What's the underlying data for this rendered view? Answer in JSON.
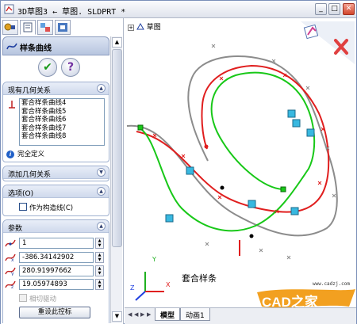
{
  "window": {
    "title": "3D草图3 ← 草图. SLDPRT *",
    "buttons": {
      "minimize": "_",
      "maximize": "□",
      "close": "✕"
    }
  },
  "panel_tabs": [
    "feature-manager",
    "property-manager",
    "configuration-manager",
    "dimxpert-manager"
  ],
  "property_manager": {
    "title": "样条曲线",
    "ok_label": "✔",
    "help_label": "?",
    "relations_group": {
      "title": "现有几何关系",
      "items": [
        "套合样条曲线4",
        "套合样条曲线5",
        "套合样条曲线6",
        "套合样条曲线7",
        "套合样条曲线8"
      ],
      "status": "完全定义"
    },
    "add_relations_group": {
      "title": "添加几何关系"
    },
    "options_group": {
      "title": "选项(O)",
      "construction_label": "作为构造线(C)"
    },
    "parameters_group": {
      "title": "参数",
      "point_index": "1",
      "x": "-386.34142902",
      "y": "280.91997662",
      "z": "19.05974893",
      "tangent_driving_label": "相切驱动",
      "reset_button": "重设此控标"
    }
  },
  "graphics": {
    "tree_node": "草图",
    "annotation": "套合样条",
    "triad_labels": {
      "x": "X",
      "y": "Y",
      "z": "Z"
    }
  },
  "bottom_tabs": {
    "items": [
      "模型",
      "动画1"
    ],
    "active": "模型"
  },
  "watermark": {
    "brand": "CAD之家",
    "url": "www.cadzj.com"
  },
  "colors": {
    "spline_red": "#e01e1e",
    "spline_green": "#18c818",
    "spline_gray": "#8c8c8c",
    "relation_icon": "#38b8e0",
    "accent": "#2060c8"
  }
}
